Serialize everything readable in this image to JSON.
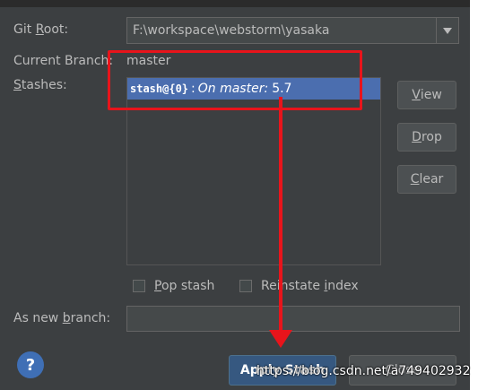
{
  "form": {
    "git_root_label_pre": "Git ",
    "git_root_label_u": "R",
    "git_root_label_post": "oot:",
    "git_root_value": "F:\\workspace\\webstorm\\yasaka",
    "current_branch_label": "Current Branch:",
    "current_branch_value": "master",
    "stashes_label_u": "S",
    "stashes_label_post": "tashes:",
    "as_new_branch_pre": "As new ",
    "as_new_branch_u": "b",
    "as_new_branch_post": "ranch:",
    "as_new_branch_value": ""
  },
  "stashes": [
    {
      "ref": "stash@{0}",
      "sep": ":",
      "desc": "On master:",
      "version": "5.7"
    }
  ],
  "side_buttons": {
    "view_u": "V",
    "view_rest": "iew",
    "drop_u": "D",
    "drop_rest": "rop",
    "clear_u": "C",
    "clear_rest": "lear"
  },
  "options": {
    "pop_u": "P",
    "pop_rest": "op stash",
    "reinstate_pre": "Reinstate ",
    "reinstate_u": "i",
    "reinstate_rest": "ndex"
  },
  "footer": {
    "help": "?",
    "apply": "Apply Stash",
    "close": "Close"
  },
  "watermark": "https://blog.csdn.net/a749402932",
  "colors": {
    "background": "#3c3f41",
    "selection": "#4b6eaf",
    "annotation": "#e8141b",
    "primary_button": "#365880"
  }
}
